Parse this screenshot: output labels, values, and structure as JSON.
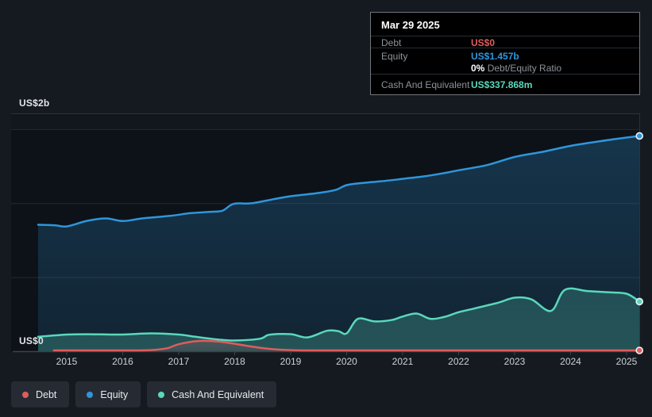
{
  "colors": {
    "debt": "#e05c5c",
    "equity": "#2e96dc",
    "cash": "#5ad8bb",
    "background": "#151a21",
    "plot_background": "#0d1218"
  },
  "tooltip": {
    "date": "Mar 29 2025",
    "debt_label": "Debt",
    "debt_value": "US$0",
    "equity_label": "Equity",
    "equity_value": "US$1.457b",
    "ratio_value": "0%",
    "ratio_label": "Debt/Equity Ratio",
    "cash_label": "Cash And Equivalent",
    "cash_value": "US$337.868m"
  },
  "axis": {
    "y_top_label": "US$2b",
    "y_bottom_label": "US$0",
    "x_ticks": [
      "2015",
      "2016",
      "2017",
      "2018",
      "2019",
      "2020",
      "2021",
      "2022",
      "2023",
      "2024",
      "2025"
    ]
  },
  "legend": [
    {
      "series": "debt",
      "label": "Debt"
    },
    {
      "series": "equity",
      "label": "Equity"
    },
    {
      "series": "cash",
      "label": "Cash And Equivalent"
    }
  ],
  "chart_data": {
    "type": "area",
    "x_unit": "year",
    "y_unit": "US$ billions",
    "xlim": [
      2014.49,
      2025.23
    ],
    "ylim": [
      0,
      2
    ],
    "gridline_values": [
      0,
      0.5,
      1.0,
      1.5
    ],
    "legend_position": "bottom-left",
    "series": [
      {
        "name": "Equity",
        "color_key": "equity",
        "points": [
          [
            2014.49,
            0.857
          ],
          [
            2014.8,
            0.853
          ],
          [
            2015.0,
            0.846
          ],
          [
            2015.37,
            0.884
          ],
          [
            2015.7,
            0.9
          ],
          [
            2016.0,
            0.882
          ],
          [
            2016.35,
            0.9
          ],
          [
            2016.85,
            0.917
          ],
          [
            2017.2,
            0.935
          ],
          [
            2017.55,
            0.944
          ],
          [
            2017.78,
            0.952
          ],
          [
            2017.98,
            0.998
          ],
          [
            2018.3,
            1.002
          ],
          [
            2018.7,
            1.03
          ],
          [
            2019.0,
            1.05
          ],
          [
            2019.5,
            1.072
          ],
          [
            2019.8,
            1.092
          ],
          [
            2020.0,
            1.125
          ],
          [
            2020.3,
            1.14
          ],
          [
            2020.6,
            1.15
          ],
          [
            2021.0,
            1.167
          ],
          [
            2021.4,
            1.185
          ],
          [
            2021.8,
            1.21
          ],
          [
            2022.0,
            1.225
          ],
          [
            2022.5,
            1.26
          ],
          [
            2023.0,
            1.315
          ],
          [
            2023.5,
            1.35
          ],
          [
            2024.0,
            1.39
          ],
          [
            2024.5,
            1.42
          ],
          [
            2025.0,
            1.446
          ],
          [
            2025.23,
            1.457
          ]
        ],
        "end_value_label": "US$1.457b"
      },
      {
        "name": "Cash And Equivalent",
        "color_key": "cash",
        "points": [
          [
            2014.49,
            0.1
          ],
          [
            2015.0,
            0.115
          ],
          [
            2015.5,
            0.117
          ],
          [
            2016.0,
            0.115
          ],
          [
            2016.5,
            0.123
          ],
          [
            2017.0,
            0.115
          ],
          [
            2017.3,
            0.1
          ],
          [
            2017.7,
            0.082
          ],
          [
            2018.0,
            0.075
          ],
          [
            2018.45,
            0.087
          ],
          [
            2018.62,
            0.114
          ],
          [
            2019.0,
            0.118
          ],
          [
            2019.3,
            0.096
          ],
          [
            2019.65,
            0.141
          ],
          [
            2019.85,
            0.138
          ],
          [
            2020.0,
            0.123
          ],
          [
            2020.2,
            0.221
          ],
          [
            2020.5,
            0.204
          ],
          [
            2020.8,
            0.213
          ],
          [
            2021.0,
            0.237
          ],
          [
            2021.25,
            0.257
          ],
          [
            2021.5,
            0.221
          ],
          [
            2021.75,
            0.235
          ],
          [
            2022.0,
            0.266
          ],
          [
            2022.3,
            0.293
          ],
          [
            2022.7,
            0.33
          ],
          [
            2023.0,
            0.364
          ],
          [
            2023.3,
            0.353
          ],
          [
            2023.65,
            0.275
          ],
          [
            2023.9,
            0.418
          ],
          [
            2024.3,
            0.409
          ],
          [
            2024.7,
            0.4
          ],
          [
            2025.0,
            0.391
          ],
          [
            2025.23,
            0.338
          ]
        ],
        "end_value_label": "US$337.868m"
      },
      {
        "name": "Debt",
        "color_key": "debt",
        "points": [
          [
            2014.77,
            0.0
          ],
          [
            2016.0,
            0.0
          ],
          [
            2016.5,
            0.002
          ],
          [
            2016.8,
            0.015
          ],
          [
            2017.0,
            0.042
          ],
          [
            2017.35,
            0.064
          ],
          [
            2017.7,
            0.06
          ],
          [
            2018.0,
            0.045
          ],
          [
            2018.3,
            0.026
          ],
          [
            2018.6,
            0.011
          ],
          [
            2018.9,
            0.003
          ],
          [
            2019.3,
            0.0
          ],
          [
            2020.0,
            0.0
          ],
          [
            2021.0,
            0.0
          ],
          [
            2022.0,
            0.0
          ],
          [
            2023.0,
            0.0
          ],
          [
            2024.0,
            0.0
          ],
          [
            2025.0,
            0.0
          ],
          [
            2025.23,
            0.0
          ]
        ],
        "end_value_label": "US$0"
      }
    ]
  }
}
